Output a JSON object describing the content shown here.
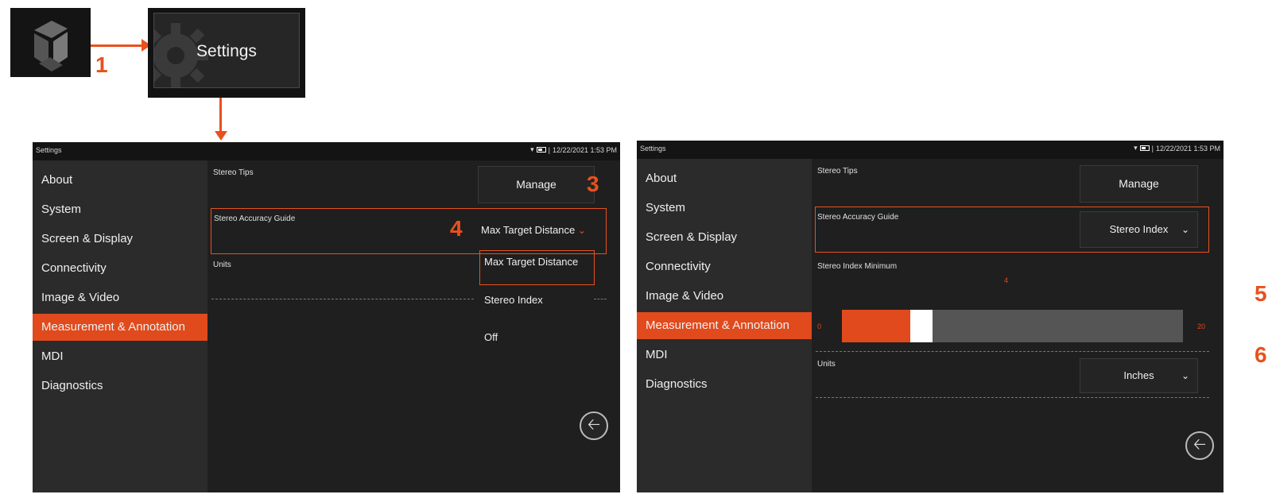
{
  "callouts": {
    "one": "1",
    "three": "3",
    "four": "4",
    "five": "5",
    "six": "6"
  },
  "settings_tile": {
    "label": "Settings",
    "icon": "gear-icon"
  },
  "app_icon": {
    "icon": "app-logo-icon"
  },
  "status": {
    "title": "Settings",
    "datetime": "12/22/2021 1:53 PM"
  },
  "sidebar": {
    "items": [
      {
        "label": "About"
      },
      {
        "label": "System"
      },
      {
        "label": "Screen & Display"
      },
      {
        "label": "Connectivity"
      },
      {
        "label": "Image & Video"
      },
      {
        "label": "Measurement & Annotation",
        "active": true
      },
      {
        "label": "MDI"
      },
      {
        "label": "Diagnostics"
      }
    ]
  },
  "left_screen": {
    "stereo_tips_label": "Stereo Tips",
    "manage_label": "Manage",
    "accuracy_label": "Stereo Accuracy Guide",
    "accuracy_value": "Max Target Distance",
    "units_label": "Units",
    "dropdown_options": [
      "Max Target Distance",
      "Stereo Index",
      "Off"
    ],
    "selected_option": "Max Target Distance"
  },
  "right_screen": {
    "stereo_tips_label": "Stereo Tips",
    "manage_label": "Manage",
    "accuracy_label": "Stereo Accuracy Guide",
    "accuracy_value": "Stereo Index",
    "index_min_label": "Stereo Index Minimum",
    "slider": {
      "min": "0",
      "max": "20",
      "value": "4",
      "value_num": 4,
      "min_num": 0,
      "max_num": 20
    },
    "units_label": "Units",
    "units_value": "Inches"
  },
  "colors": {
    "accent": "#e04a1c",
    "callout": "#e8511d",
    "content_bg": "#1f1f1f",
    "sidebar_bg": "#2b2b2b"
  }
}
